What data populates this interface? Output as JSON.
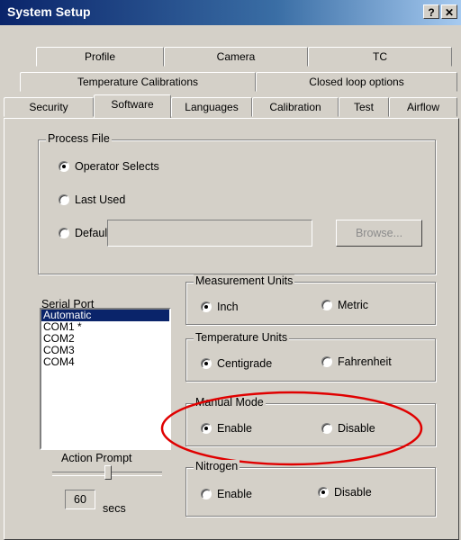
{
  "window": {
    "title": "System Setup",
    "help_btn": "?",
    "close_btn": "✕"
  },
  "tabs_row1": [
    "Profile",
    "Camera",
    "TC"
  ],
  "tabs_row2": [
    "Temperature Calibrations",
    "Closed loop options"
  ],
  "tabs_row3": [
    "Security",
    "Software",
    "Languages",
    "Calibration",
    "Test",
    "Airflow"
  ],
  "active_tab": "Software",
  "process_file": {
    "label": "Process File",
    "options": [
      "Operator Selects",
      "Last Used",
      "Default"
    ],
    "selected": "Operator Selects",
    "default_value": "",
    "browse_label": "Browse..."
  },
  "serial_port": {
    "label": "Serial Port",
    "items": [
      "Automatic",
      "COM1 *",
      "COM2",
      "COM3",
      "COM4"
    ],
    "selected": "Automatic"
  },
  "measurement_units": {
    "label": "Measurement Units",
    "options": [
      "Inch",
      "Metric"
    ],
    "selected": "Inch"
  },
  "temperature_units": {
    "label": "Temperature Units",
    "options": [
      "Centigrade",
      "Fahrenheit"
    ],
    "selected": "Centigrade"
  },
  "manual_mode": {
    "label": "Manual Mode",
    "options": [
      "Enable",
      "Disable"
    ],
    "selected": "Enable"
  },
  "nitrogen": {
    "label": "Nitrogen",
    "options": [
      "Enable",
      "Disable"
    ],
    "selected": "Disable"
  },
  "action_prompt": {
    "label": "Action Prompt",
    "value": "60",
    "unit": "secs"
  },
  "colors": {
    "annotation": "#e00000",
    "selection": "#0a246a"
  }
}
